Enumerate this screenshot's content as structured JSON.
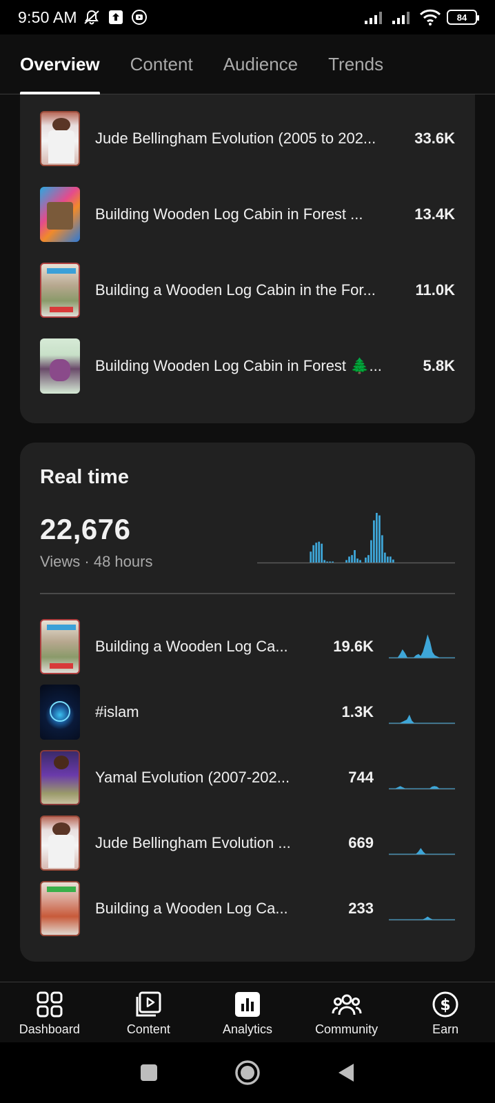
{
  "status_bar": {
    "time": "9:50 AM",
    "battery": "84",
    "icons": [
      "mute-icon",
      "upload-icon",
      "youtube-studio-icon",
      "signal-icon",
      "signal-icon",
      "wifi-icon",
      "battery-icon"
    ]
  },
  "tabs": [
    {
      "label": "Overview",
      "active": true
    },
    {
      "label": "Content",
      "active": false
    },
    {
      "label": "Audience",
      "active": false
    },
    {
      "label": "Trends",
      "active": false
    }
  ],
  "top_content": {
    "items": [
      {
        "title": "Jude Bellingham Evolution (2005 to 202...",
        "value": "33.6K"
      },
      {
        "title": "Building Wooden Log Cabin in Forest ...",
        "value": "13.4K"
      },
      {
        "title": "Building a Wooden Log Cabin in the For...",
        "value": "11.0K"
      },
      {
        "title": "Building Wooden Log Cabin in Forest 🌲...",
        "value": "5.8K"
      }
    ]
  },
  "realtime": {
    "title": "Real time",
    "views": "22,676",
    "subtitle": "Views · 48 hours",
    "bars": [
      0,
      0,
      0,
      0,
      0,
      0,
      0,
      0,
      0,
      0,
      0,
      0,
      0,
      0,
      0,
      0,
      0,
      0,
      0,
      0.22,
      0.35,
      0.4,
      0.42,
      0.38,
      0.05,
      0.02,
      0.02,
      0.02,
      0,
      0,
      0,
      0,
      0.05,
      0.12,
      0.15,
      0.25,
      0.08,
      0.05,
      0,
      0.1,
      0.15,
      0.45,
      0.85,
      1.0,
      0.95,
      0.55,
      0.2,
      0.12,
      0.12,
      0.06,
      0,
      0,
      0,
      0,
      0,
      0,
      0,
      0,
      0,
      0,
      0,
      0,
      0,
      0,
      0,
      0,
      0,
      0,
      0,
      0,
      0,
      0
    ],
    "accent": "#3ea6d8",
    "items": [
      {
        "title": "Building a Wooden Log Ca...",
        "value": "19.6K",
        "spark": [
          0,
          0,
          0,
          0,
          0,
          0.15,
          0.35,
          0.2,
          0,
          0,
          0,
          0,
          0.1,
          0.15,
          0.05,
          0.25,
          0.6,
          1.0,
          0.7,
          0.25,
          0.1,
          0.05,
          0,
          0,
          0,
          0,
          0,
          0,
          0,
          0
        ]
      },
      {
        "title": "#islam",
        "value": "1.3K",
        "spark": [
          0,
          0,
          0,
          0,
          0,
          0,
          0.05,
          0.1,
          0.15,
          0.35,
          0.1,
          0,
          0,
          0,
          0,
          0,
          0,
          0,
          0,
          0,
          0,
          0,
          0,
          0,
          0,
          0,
          0,
          0,
          0,
          0
        ]
      },
      {
        "title": "Yamal Evolution (2007-202...",
        "value": "744",
        "spark": [
          0,
          0,
          0,
          0,
          0.05,
          0.1,
          0.05,
          0,
          0,
          0,
          0,
          0,
          0,
          0,
          0,
          0,
          0,
          0,
          0,
          0.08,
          0.1,
          0.08,
          0,
          0,
          0,
          0,
          0,
          0,
          0,
          0
        ]
      },
      {
        "title": "Jude Bellingham Evolution ...",
        "value": "669",
        "spark": [
          0,
          0,
          0,
          0,
          0,
          0,
          0,
          0,
          0,
          0,
          0,
          0,
          0,
          0.1,
          0.25,
          0.1,
          0,
          0,
          0,
          0,
          0,
          0,
          0,
          0,
          0,
          0,
          0,
          0,
          0,
          0
        ]
      },
      {
        "title": "Building a Wooden Log Ca...",
        "value": "233",
        "spark": [
          0,
          0,
          0,
          0,
          0,
          0,
          0,
          0,
          0,
          0,
          0,
          0,
          0,
          0,
          0,
          0,
          0.05,
          0.12,
          0.05,
          0,
          0,
          0,
          0,
          0,
          0,
          0,
          0,
          0,
          0,
          0
        ]
      }
    ]
  },
  "bottom_nav": [
    {
      "label": "Dashboard",
      "icon": "dashboard-icon"
    },
    {
      "label": "Content",
      "icon": "content-icon"
    },
    {
      "label": "Analytics",
      "icon": "analytics-icon",
      "active": true
    },
    {
      "label": "Community",
      "icon": "community-icon"
    },
    {
      "label": "Earn",
      "icon": "earn-icon"
    }
  ]
}
